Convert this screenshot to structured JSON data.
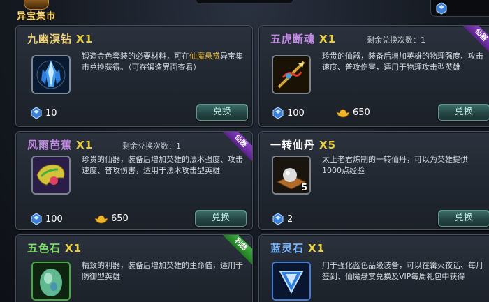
{
  "header": {
    "title": "异宝集市"
  },
  "colors": {
    "title_yellow": "#f2d37a",
    "title_purple": "#c58ae8",
    "title_green": "#7fe06a",
    "title_blue": "#7ab8ff",
    "qty_yellow": "#e8cf3a",
    "highlight": "#e6b93a"
  },
  "items": [
    {
      "name": "九幽溟钻",
      "qty": "X1",
      "remain": "",
      "ribbon": "",
      "desc_pre": "锻造金色套装的必要材料，可在",
      "desc_hl": "仙魔悬赏",
      "desc_post": "异宝集市兑换获得。（可在锻造界面查看）",
      "cost_gem": "10",
      "cost_gold": "",
      "button": "兑换",
      "icon": "blue-crystal-icon",
      "stack": ""
    },
    {
      "name": "五虎断魂",
      "qty": "X1",
      "remain": "剩余兑换次数：1",
      "ribbon": "仙器",
      "desc_pre": "珍贵的仙器，装备后增加英雄的物理强度、攻击速度、普攻伤害，适用于物理攻击型英雄",
      "desc_hl": "",
      "desc_post": "",
      "cost_gem": "100",
      "cost_gold": "650",
      "button": "兑换",
      "icon": "dragon-spear-icon",
      "stack": ""
    },
    {
      "name": "风雨芭蕉",
      "qty": "X1",
      "remain": "剩余兑换次数：1",
      "ribbon": "仙器",
      "desc_pre": "珍贵的仙器，装备后增加英雄的法术强度、攻击速度、普攻伤害，适用于法术攻击型英雄",
      "desc_hl": "",
      "desc_post": "",
      "cost_gem": "100",
      "cost_gold": "650",
      "button": "兑换",
      "icon": "banana-fan-icon",
      "stack": ""
    },
    {
      "name": "一转仙丹",
      "qty": "X5",
      "remain": "",
      "ribbon": "",
      "desc_pre": "太上老君炼制的一转仙丹，可以为英雄提供1000点经验",
      "desc_hl": "",
      "desc_post": "",
      "cost_gem": "2",
      "cost_gold": "",
      "button": "兑换",
      "icon": "pill-icon",
      "stack": "5"
    },
    {
      "name": "五色石",
      "qty": "X1",
      "remain": "",
      "ribbon": "利器",
      "desc_pre": "精致的利器，装备后增加英雄的生命值，适用于防御型英雄",
      "desc_hl": "",
      "desc_post": "",
      "cost_gem": "",
      "cost_gold": "",
      "button": "",
      "icon": "five-color-stone-icon",
      "stack": ""
    },
    {
      "name": "蓝灵石",
      "qty": "X1",
      "remain": "",
      "ribbon": "",
      "desc_pre": "用于强化蓝色品级装备，可以在篝火夜话、每月签到、仙魔悬赏兑换及VIP每周礼包中获得",
      "desc_hl": "",
      "desc_post": "",
      "cost_gem": "",
      "cost_gold": "",
      "button": "",
      "icon": "blue-spirit-stone-icon",
      "stack": ""
    }
  ]
}
